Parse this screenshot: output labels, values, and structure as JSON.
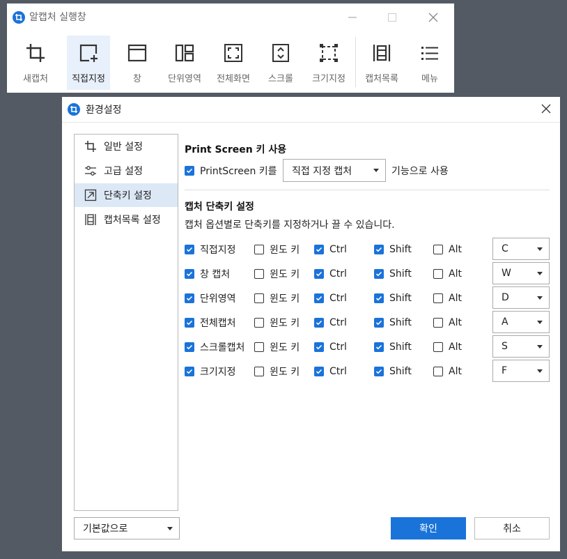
{
  "capture_window": {
    "title": "알캡처 실행창",
    "tools": [
      {
        "label": "새캡처",
        "icon": "new-capture-icon"
      },
      {
        "label": "직접지정",
        "icon": "direct-capture-icon"
      },
      {
        "label": "창",
        "icon": "window-capture-icon"
      },
      {
        "label": "단위영역",
        "icon": "unit-area-icon"
      },
      {
        "label": "전체화면",
        "icon": "fullscreen-icon"
      },
      {
        "label": "스크롤",
        "icon": "scroll-capture-icon"
      },
      {
        "label": "크기지정",
        "icon": "fixed-size-icon"
      },
      {
        "label": "캡처목록",
        "icon": "capture-list-icon"
      },
      {
        "label": "메뉴",
        "icon": "menu-icon"
      }
    ],
    "active_tool": "직접지정"
  },
  "settings_window": {
    "title": "환경설정",
    "nav": [
      {
        "label": "일반 설정",
        "icon": "crop-icon"
      },
      {
        "label": "고급 설정",
        "icon": "sliders-icon"
      },
      {
        "label": "단축키 설정",
        "icon": "shortcut-arrow-icon"
      },
      {
        "label": "캡처목록 설정",
        "icon": "capture-list-icon"
      }
    ],
    "selected_nav": "단축키 설정",
    "print_screen": {
      "section_title": "Print Screen 키 사용",
      "checkbox_label": "PrintScreen 키를",
      "checked": true,
      "selected_function": "직접 지정 캡처",
      "suffix": "기능으로 사용"
    },
    "hotkeys": {
      "section_title": "캡처 단축키 설정",
      "description": "캡처 옵션별로 단축키를 지정하거나 끌 수 있습니다.",
      "win_label": "윈도 키",
      "ctrl_label": "Ctrl",
      "shift_label": "Shift",
      "alt_label": "Alt",
      "rows": [
        {
          "name": "직접지정",
          "enabled": true,
          "win": false,
          "ctrl": true,
          "shift": true,
          "alt": false,
          "key": "C"
        },
        {
          "name": "창 캡처",
          "enabled": true,
          "win": false,
          "ctrl": true,
          "shift": true,
          "alt": false,
          "key": "W"
        },
        {
          "name": "단위영역",
          "enabled": true,
          "win": false,
          "ctrl": true,
          "shift": true,
          "alt": false,
          "key": "D"
        },
        {
          "name": "전체캡처",
          "enabled": true,
          "win": false,
          "ctrl": true,
          "shift": true,
          "alt": false,
          "key": "A"
        },
        {
          "name": "스크롤캡처",
          "enabled": true,
          "win": false,
          "ctrl": true,
          "shift": true,
          "alt": false,
          "key": "S"
        },
        {
          "name": "크기지정",
          "enabled": true,
          "win": false,
          "ctrl": true,
          "shift": true,
          "alt": false,
          "key": "F"
        }
      ]
    },
    "defaults_label": "기본값으로",
    "ok_label": "확인",
    "cancel_label": "취소"
  },
  "colors": {
    "accent": "#1a73d9",
    "background": "#535a63",
    "selected_bg": "#dde8f6"
  }
}
